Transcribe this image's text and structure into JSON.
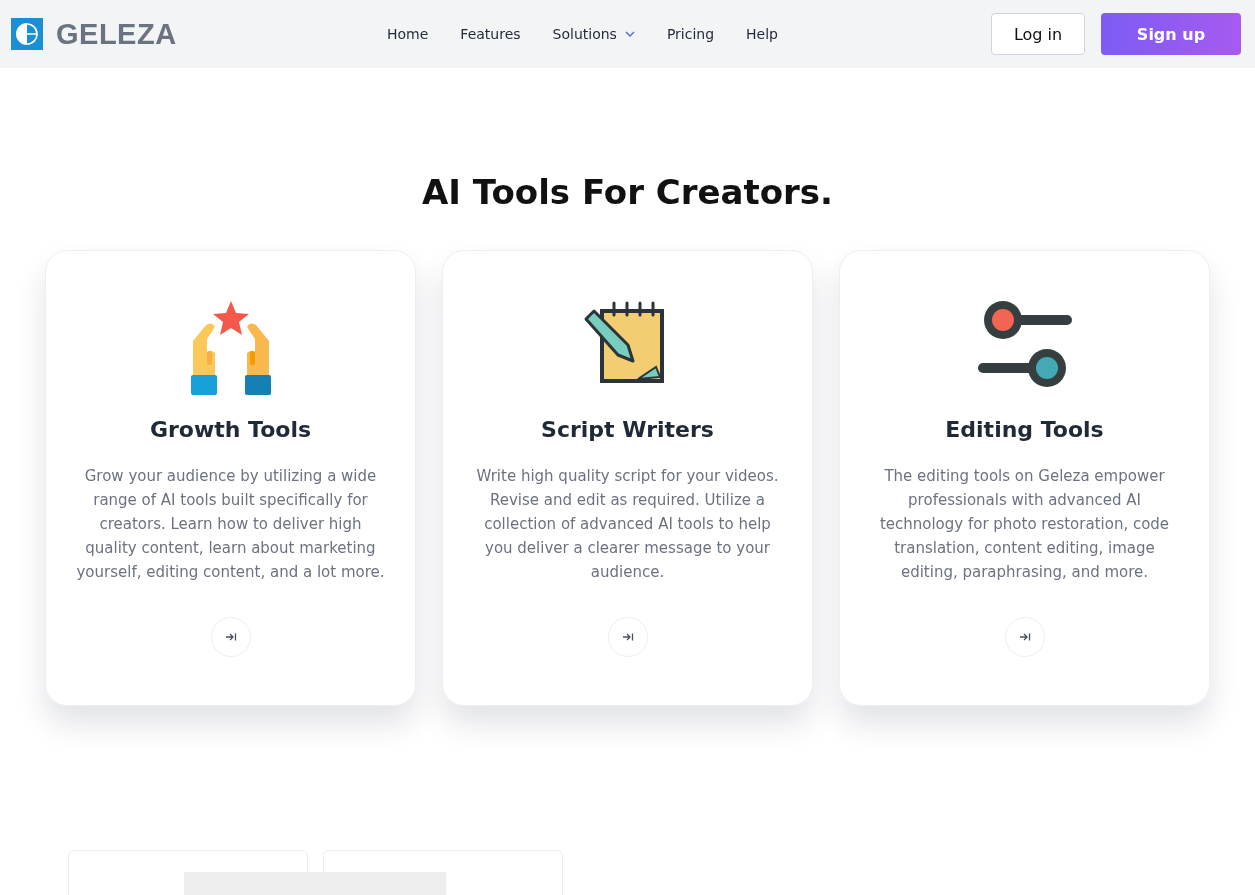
{
  "header": {
    "logo": {
      "text": "GELEZA"
    },
    "nav": [
      {
        "label": "Home",
        "dropdown": false
      },
      {
        "label": "Features",
        "dropdown": false
      },
      {
        "label": "Solutions",
        "dropdown": true
      },
      {
        "label": "Pricing",
        "dropdown": false
      },
      {
        "label": "Help",
        "dropdown": false
      }
    ],
    "login": "Log in",
    "signup": "Sign up"
  },
  "section": {
    "title": "AI Tools For Creators.",
    "cards": [
      {
        "kind": "hands-star",
        "title": "Growth Tools",
        "text": "Grow your audience by utilizing a wide range of AI tools built specifically for creators. Learn how to deliver high quality content, learn about marketing yourself, editing content, and a lot more."
      },
      {
        "kind": "notepad",
        "title": "Script Writers",
        "text": "Write high quality script for your videos. Revise and edit as required. Utilize a collection of advanced AI tools to help you deliver a clearer message to your audience."
      },
      {
        "kind": "sliders",
        "title": "Editing Tools",
        "text": "The editing tools on Geleza empower professionals with advanced AI technology for photo restoration, code translation, content editing, image editing, paraphrasing, and more."
      }
    ]
  }
}
